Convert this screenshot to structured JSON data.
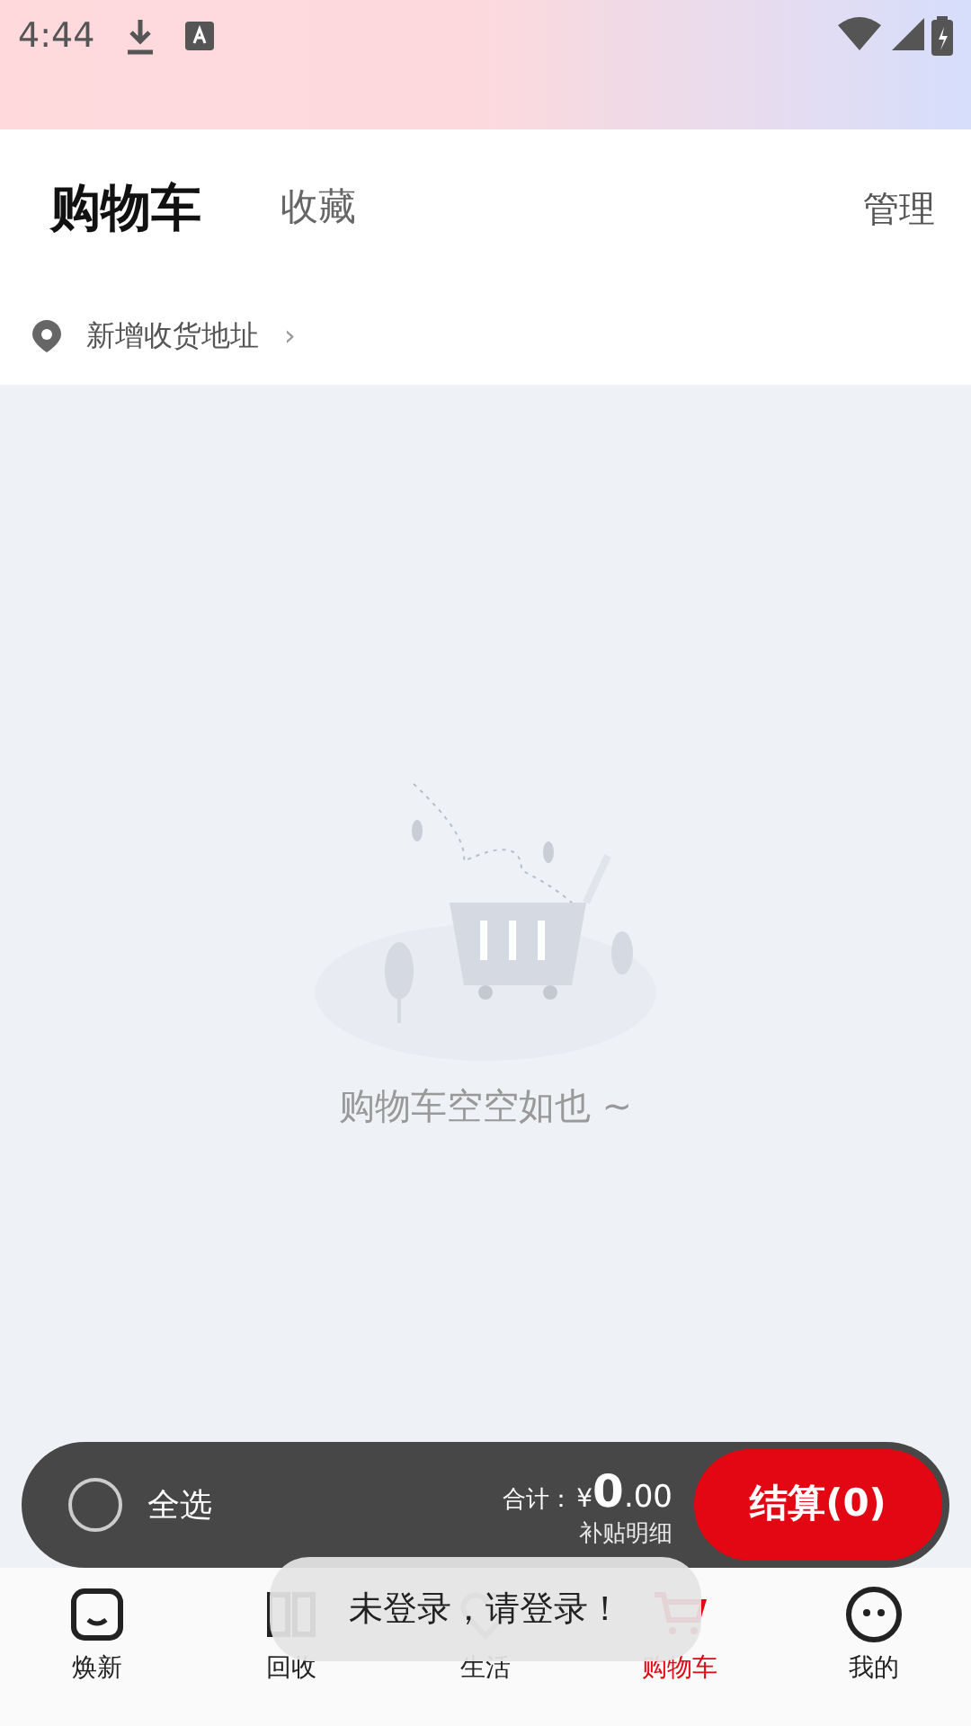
{
  "status_bar": {
    "time": "4:44"
  },
  "header": {
    "tabs": [
      {
        "label": "购物车",
        "selected": true
      },
      {
        "label": "收藏",
        "selected": false
      }
    ],
    "action": "管理"
  },
  "address": {
    "label": "新增收货地址",
    "chevron": "›"
  },
  "empty_state": {
    "message": "购物车空空如也 ~"
  },
  "checkout_bar": {
    "select_all": {
      "label": "全选",
      "checked": false
    },
    "total_label": "合计：",
    "currency": "¥",
    "amount_int": "0",
    "amount_dec": ".00",
    "subsidy": "补贴明细",
    "checkout_button": "结算(0)"
  },
  "bottom_nav": [
    {
      "label": "焕新",
      "kind": "face",
      "selected": false
    },
    {
      "label": "回收",
      "kind": "book",
      "selected": false
    },
    {
      "label": "生活",
      "kind": "heart",
      "selected": false
    },
    {
      "label": "购物车",
      "kind": "cart",
      "selected": true
    },
    {
      "label": "我的",
      "kind": "smile",
      "selected": false
    }
  ],
  "toast": {
    "message": "未登录，请登录！"
  }
}
